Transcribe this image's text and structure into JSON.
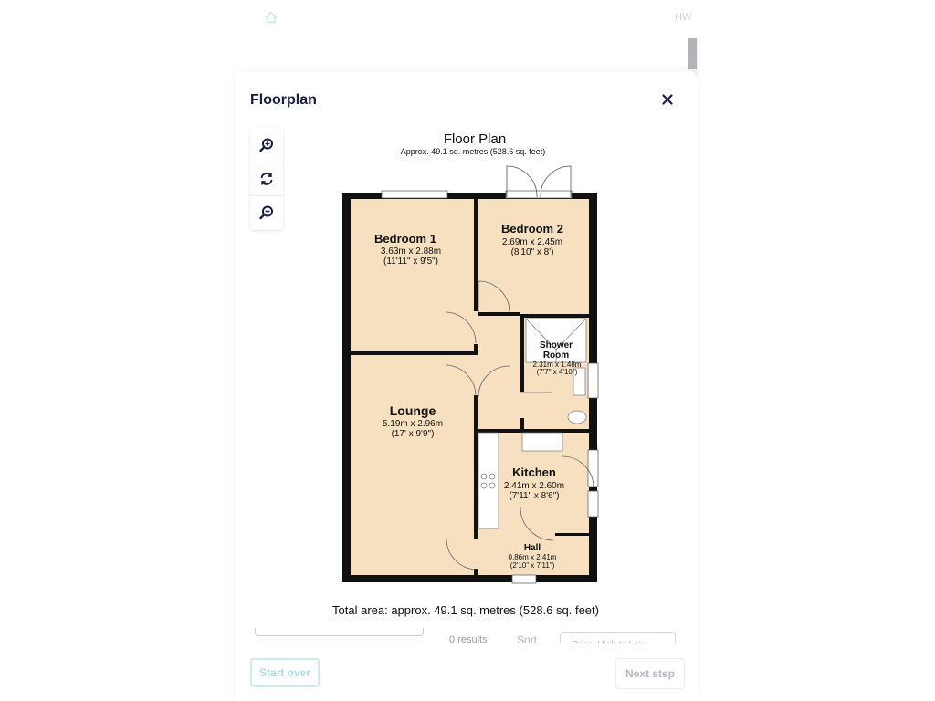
{
  "header": {
    "initials": "HW"
  },
  "modal": {
    "title": "Floorplan",
    "zoom_in_label": "Zoom in",
    "rotate_label": "Rotate",
    "zoom_out_label": "Zoom out"
  },
  "floorplan": {
    "title": "Floor Plan",
    "subtitle": "Approx. 49.1 sq. metres (528.6 sq. feet)",
    "total_area": "Total area: approx. 49.1 sq. metres (528.6 sq. feet)",
    "rooms": {
      "bedroom1": {
        "name": "Bedroom 1",
        "metric": "3.63m x 2.88m",
        "imperial": "(11'11\" x 9'5\")"
      },
      "bedroom2": {
        "name": "Bedroom 2",
        "metric": "2.69m x 2.45m",
        "imperial": "(8'10\" x 8')"
      },
      "shower": {
        "name1": "Shower",
        "name2": "Room",
        "metric": "2.31m x 1.48m",
        "imperial": "(7'7\" x 4'10\")"
      },
      "lounge": {
        "name": "Lounge",
        "metric": "5.19m x 2.96m",
        "imperial": "(17' x 9'9\")"
      },
      "kitchen": {
        "name": "Kitchen",
        "metric": "2.41m x 2.60m",
        "imperial": "(7'11\" x 8'6\")"
      },
      "hall": {
        "name": "Hall",
        "metric": "0.86m x 2.41m",
        "imperial": "(2'10\" x 7'11\")"
      }
    },
    "colors": {
      "floor": "#f6e0c0",
      "wall": "#111111",
      "window": "#ffffff"
    }
  },
  "results": {
    "count": "0 results",
    "sort_label": "Sort",
    "sort_value": "Price: High to Low"
  },
  "footer": {
    "start_over": "Start over",
    "next_step": "Next step"
  }
}
